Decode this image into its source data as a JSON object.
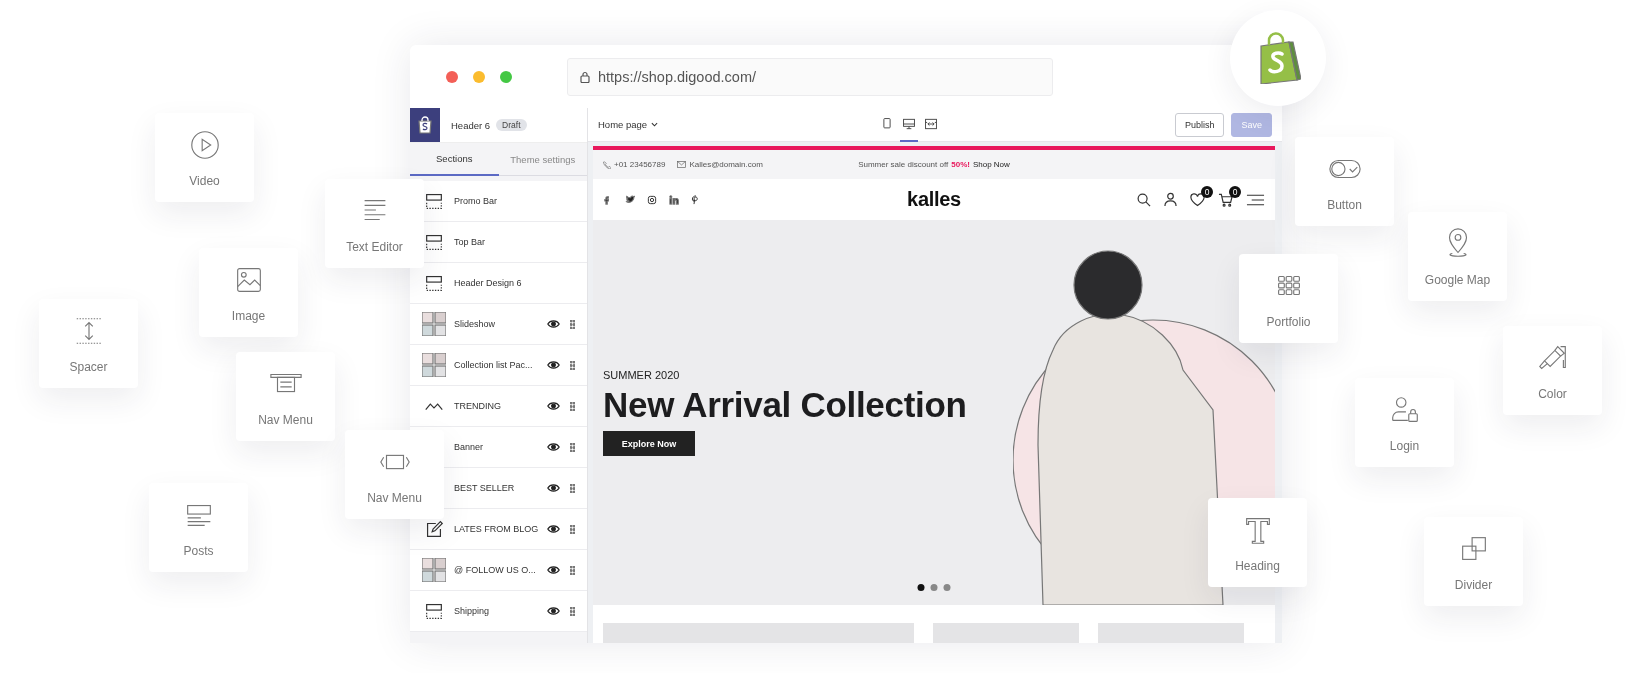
{
  "browser": {
    "url": "https://shop.digood.com/"
  },
  "editor": {
    "title": "Header 6",
    "badge": "Draft",
    "page_select": "Home page",
    "device_views": [
      {
        "kind": "mobile",
        "selected": false
      },
      {
        "kind": "desktop",
        "selected": true
      },
      {
        "kind": "full_width",
        "selected": false
      }
    ],
    "actions": [
      {
        "label": "Publish",
        "kind": "secondary",
        "disabled": false
      },
      {
        "label": "Save",
        "kind": "primary",
        "disabled": true
      }
    ]
  },
  "sidebar": {
    "tabs": [
      {
        "label": "Sections",
        "selected": true
      },
      {
        "label": "Theme settings",
        "selected": false
      }
    ],
    "sections": [
      {
        "label": "Promo Bar",
        "kind": "static"
      },
      {
        "label": "Top Bar",
        "kind": "static"
      },
      {
        "label": "Header Design 6",
        "kind": "static"
      },
      {
        "label": "Slideshow",
        "kind": "photos"
      },
      {
        "label": "Collection list Pac...",
        "kind": "photos"
      },
      {
        "label": "TRENDING",
        "kind": "collection"
      },
      {
        "label": "Banner",
        "kind": "section"
      },
      {
        "label": "BEST SELLER",
        "kind": "section"
      },
      {
        "label": "LATES FROM BLOG",
        "kind": "blog"
      },
      {
        "label": "@ FOLLOW US O...",
        "kind": "photos"
      },
      {
        "label": "Shipping",
        "kind": "section"
      }
    ]
  },
  "store": {
    "topbar": {
      "phone": "+01 23456789",
      "email": "Kalles@domain.com",
      "announcement": "Summer sale discount off",
      "discount": "50%!",
      "link": "Shop Now"
    },
    "logo": "kalles",
    "wishlist_count": "0",
    "cart_count": "0",
    "hero": {
      "eyebrow": "SUMMER 2020",
      "title": "New Arrival Collection",
      "button": "Explore Now",
      "slides": [
        {
          "selected": true
        },
        {
          "selected": false
        },
        {
          "selected": false
        }
      ]
    }
  },
  "widgets": [
    {
      "label": "Video",
      "kind": "video"
    },
    {
      "label": "Text Editor",
      "kind": "text"
    },
    {
      "label": "Image",
      "kind": "image"
    },
    {
      "label": "Spacer",
      "kind": "spacer"
    },
    {
      "label": "Nav Menu",
      "kind": "nav_menu"
    },
    {
      "label": "Nav Menu",
      "kind": "nav_slider"
    },
    {
      "label": "Posts",
      "kind": "posts"
    },
    {
      "label": "Button",
      "kind": "toggle"
    },
    {
      "label": "Google Map",
      "kind": "map"
    },
    {
      "label": "Portfolio",
      "kind": "grid"
    },
    {
      "label": "Color",
      "kind": "paint"
    },
    {
      "label": "Login",
      "kind": "login"
    },
    {
      "label": "Heading",
      "kind": "heading"
    },
    {
      "label": "Divider",
      "kind": "divider"
    }
  ]
}
